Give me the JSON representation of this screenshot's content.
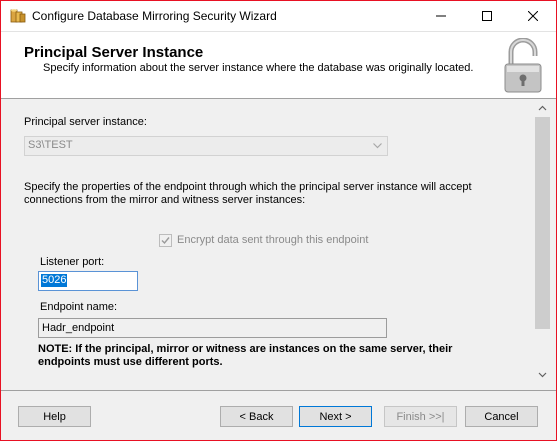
{
  "window": {
    "title": "Configure Database Mirroring Security Wizard"
  },
  "header": {
    "title": "Principal Server Instance",
    "subtitle": "Specify information about the server instance where the database was originally located."
  },
  "form": {
    "instance_label": "Principal server instance:",
    "instance_value": "S3\\TEST",
    "description": "Specify the properties of the endpoint through which the principal server instance will accept connections from the mirror and witness server instances:",
    "encrypt_label": "Encrypt data sent through this endpoint",
    "encrypt_checked": true,
    "listener_label": "Listener port:",
    "listener_value": "5026",
    "endpoint_label": "Endpoint name:",
    "endpoint_value": "Hadr_endpoint",
    "note": "NOTE: If the principal, mirror or witness are instances on the same server, their endpoints must use different ports."
  },
  "buttons": {
    "help": "Help",
    "back": "< Back",
    "next": "Next >",
    "finish": "Finish >>|",
    "cancel": "Cancel"
  },
  "colors": {
    "close_border": "#e81123",
    "selection": "#0078d7",
    "disabled_text": "#8a8a8a"
  }
}
